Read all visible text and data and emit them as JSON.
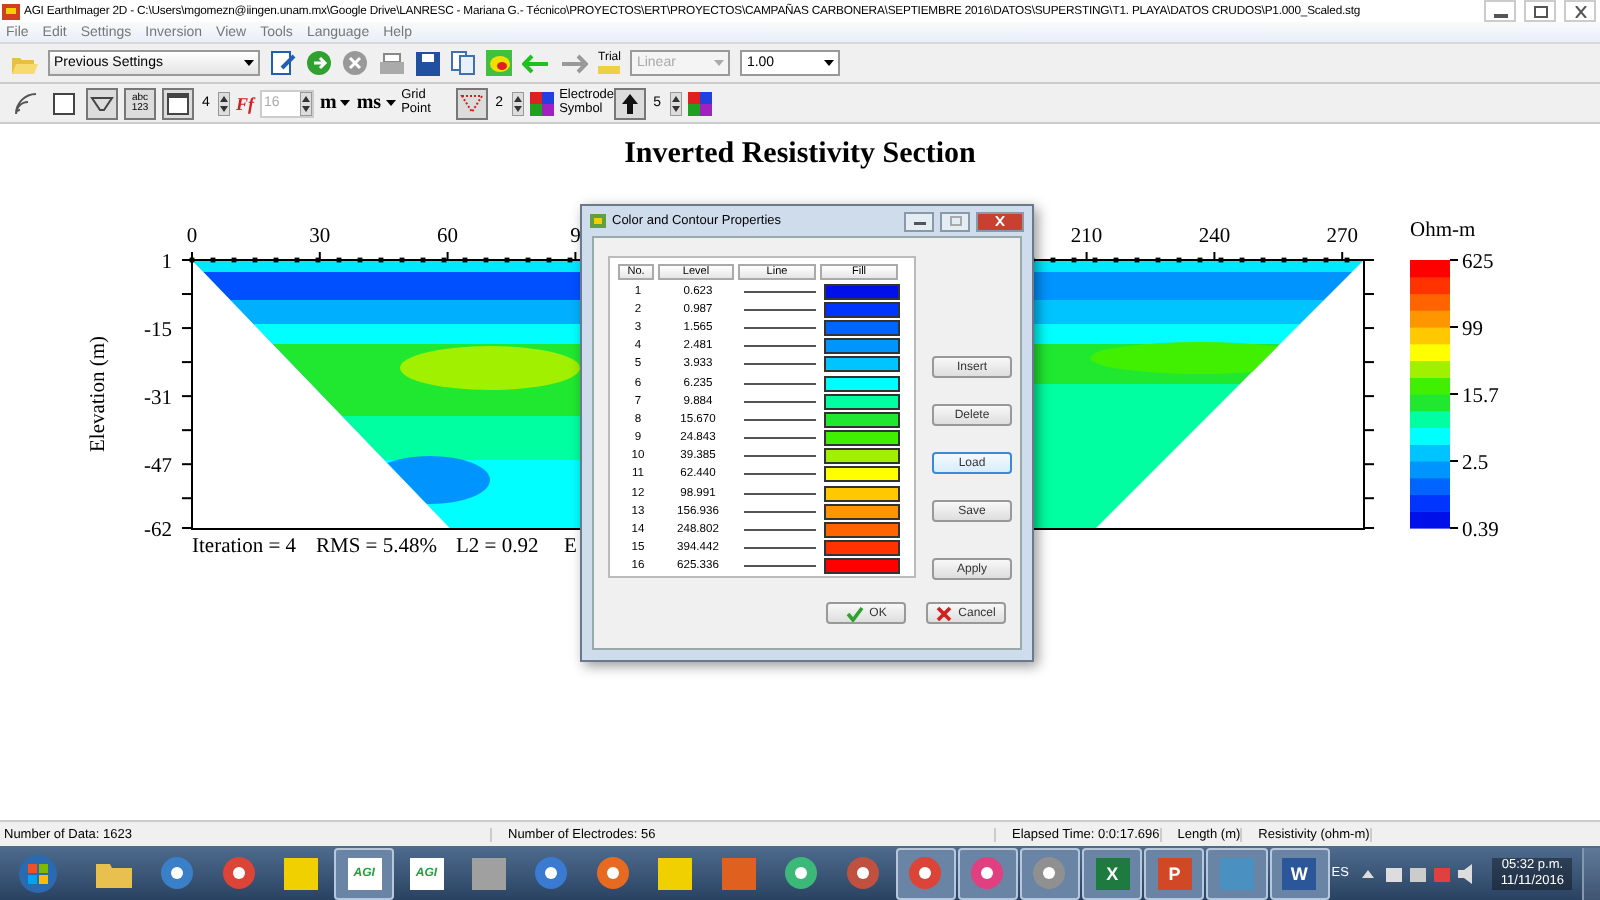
{
  "window": {
    "title": "AGI EarthImager 2D - C:\\Users\\mgomezn@iingen.unam.mx\\Google Drive\\LANRESC - Mariana G.- Técnico\\PROYECTOS\\ERT\\PROYECTOS\\CAMPAÑAS CARBONERA\\SEPTIEMBRE 2016\\DATOS\\SUPERSTING\\T1. PLAYA\\DATOS CRUDOS\\P1.000_Scaled.stg"
  },
  "menu": [
    "File",
    "Edit",
    "Settings",
    "Inversion",
    "View",
    "Tools",
    "Language",
    "Help"
  ],
  "toolbar_1": [
    {
      "kind": "open"
    },
    {
      "kind": "dropdown",
      "value": "Previous Settings",
      "disabled": false
    },
    {
      "kind": "edit"
    },
    {
      "kind": "run"
    },
    {
      "kind": "stop"
    },
    {
      "kind": "print"
    },
    {
      "kind": "save"
    },
    {
      "kind": "copy"
    },
    {
      "kind": "map"
    },
    {
      "kind": "back"
    },
    {
      "kind": "forward"
    },
    {
      "kind": "trial",
      "label": "Trial"
    },
    {
      "kind": "dropdown",
      "value": "Linear",
      "disabled": true
    },
    {
      "kind": "dropdown",
      "value": "1.00",
      "disabled": false
    }
  ],
  "toolbar_2": [
    {
      "kind": "signal",
      "pressed": false
    },
    {
      "kind": "frame",
      "pressed": false
    },
    {
      "kind": "trapezoid",
      "pressed": true
    },
    {
      "kind": "numbers",
      "label": "abc 123",
      "pressed": true
    },
    {
      "kind": "window",
      "pressed": true
    },
    {
      "kind": "spinner",
      "value": "4",
      "disabled": false
    },
    {
      "kind": "font",
      "label": "Ff"
    },
    {
      "kind": "spinner",
      "value": "16",
      "disabled": true
    },
    {
      "kind": "menu",
      "label": "m"
    },
    {
      "kind": "menu",
      "label": "ms"
    },
    {
      "kind": "label",
      "text": "Grid Point"
    },
    {
      "kind": "grid",
      "pressed": true
    },
    {
      "kind": "spinner",
      "value": "2",
      "disabled": false
    },
    {
      "kind": "palette"
    },
    {
      "kind": "label",
      "text": "Electrode Symbol"
    },
    {
      "kind": "up",
      "pressed": true
    },
    {
      "kind": "spinner",
      "value": "5",
      "disabled": false
    },
    {
      "kind": "palette"
    }
  ],
  "section": {
    "title": "Inverted Resistivity Section",
    "ylabel": "Elevation (m)",
    "xticks": [
      "0",
      "30",
      "60",
      "9",
      "210",
      "240",
      "270"
    ],
    "yticks": [
      "1",
      "-15",
      "-31",
      "-47",
      "-62"
    ],
    "footer": [
      "Iteration = 4",
      "RMS = 5.48%",
      "L2 = 0.92",
      "E"
    ],
    "colorbar": {
      "unit": "Ohm-m",
      "labels": [
        "625",
        "99",
        "15.7",
        "2.5",
        "0.39"
      ]
    }
  },
  "dialog": {
    "title": "Color and Contour Properties",
    "columns": [
      "No.",
      "Level",
      "Line",
      "Fill"
    ],
    "rows": [
      {
        "no": "1",
        "level": "0.623",
        "color": "#0010e8"
      },
      {
        "no": "2",
        "level": "0.987",
        "color": "#0034ff"
      },
      {
        "no": "3",
        "level": "1.565",
        "color": "#0064ff"
      },
      {
        "no": "4",
        "level": "2.481",
        "color": "#0094ff"
      },
      {
        "no": "5",
        "level": "3.933",
        "color": "#00c4ff"
      },
      {
        "no": "6",
        "level": "6.235",
        "color": "#00ffff"
      },
      {
        "no": "7",
        "level": "9.884",
        "color": "#00ffa0"
      },
      {
        "no": "8",
        "level": "15.670",
        "color": "#20e830"
      },
      {
        "no": "9",
        "level": "24.843",
        "color": "#40f000"
      },
      {
        "no": "10",
        "level": "39.385",
        "color": "#a0f000"
      },
      {
        "no": "11",
        "level": "62.440",
        "color": "#ffff00"
      },
      {
        "no": "12",
        "level": "98.991",
        "color": "#ffc800"
      },
      {
        "no": "13",
        "level": "156.936",
        "color": "#ff9600"
      },
      {
        "no": "14",
        "level": "248.802",
        "color": "#ff6400"
      },
      {
        "no": "15",
        "level": "394.442",
        "color": "#ff3200"
      },
      {
        "no": "16",
        "level": "625.336",
        "color": "#ff0000"
      }
    ],
    "side_buttons": [
      {
        "label": "Insert",
        "focused": false
      },
      {
        "label": "Delete",
        "focused": false
      },
      {
        "label": "Load",
        "focused": true
      },
      {
        "label": "Save",
        "focused": false
      },
      {
        "label": "Apply",
        "focused": false
      }
    ],
    "ok": "OK",
    "cancel": "Cancel"
  },
  "status_bar": [
    "Number of Data: 1623",
    "Number of Electrodes: 56",
    "Elapsed Time:  0:0:17.696",
    "Length (m)",
    "Resistivity (ohm-m)"
  ],
  "taskbar": {
    "items": [
      {
        "kind": "start"
      },
      {
        "kind": "folder",
        "open": false
      },
      {
        "kind": "round",
        "color": "#3a80c8",
        "open": false
      },
      {
        "kind": "round",
        "color": "#db4437",
        "open": false
      },
      {
        "kind": "tile",
        "color": "#f0d000",
        "open": false
      },
      {
        "kind": "tile",
        "color": "#ffffff",
        "letter": "AGI",
        "open": true
      },
      {
        "kind": "tile",
        "color": "#ffffff",
        "letter": "AGI",
        "open": false
      },
      {
        "kind": "tile",
        "color": "#a0a0a0",
        "open": false
      },
      {
        "kind": "round",
        "color": "#3a7ad0",
        "open": false
      },
      {
        "kind": "round",
        "color": "#e76a20",
        "open": false
      },
      {
        "kind": "tile",
        "color": "#f0d000",
        "open": false
      },
      {
        "kind": "tile",
        "color": "#e06020",
        "open": false
      },
      {
        "kind": "round",
        "color": "#3cb878",
        "open": false
      },
      {
        "kind": "round",
        "color": "#c05040",
        "open": false
      },
      {
        "kind": "round",
        "color": "#db4437",
        "open": true
      },
      {
        "kind": "round",
        "color": "#e04080",
        "open": true
      },
      {
        "kind": "round",
        "color": "#909090",
        "open": true
      },
      {
        "kind": "tile",
        "color": "#1f7a3f",
        "letter": "X",
        "open": true
      },
      {
        "kind": "tile",
        "color": "#d24726",
        "letter": "P",
        "open": true
      },
      {
        "kind": "tile",
        "color": "#4a90c0",
        "open": true
      },
      {
        "kind": "tile",
        "color": "#2b579a",
        "letter": "W",
        "open": true
      }
    ],
    "language": "ES",
    "time": "05:32 p.m.",
    "date": "11/11/2016"
  }
}
